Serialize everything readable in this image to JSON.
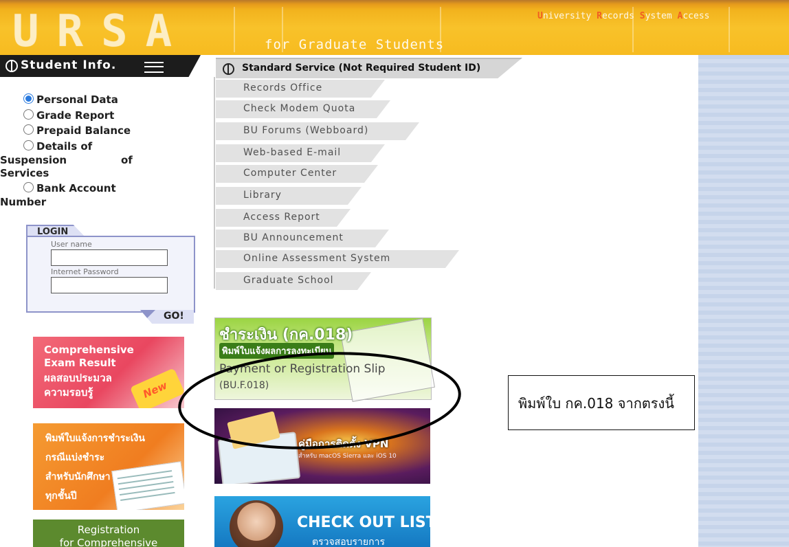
{
  "header": {
    "logo": "URSA",
    "tagline": "for Graduate Students",
    "system_title": [
      {
        "cap": "U",
        "rest": "niversity "
      },
      {
        "cap": "R",
        "rest": "ecords "
      },
      {
        "cap": "S",
        "rest": "ystem "
      },
      {
        "cap": "A",
        "rest": "ccess"
      }
    ]
  },
  "student_info": {
    "label": "Student Info.",
    "options": [
      {
        "label": "Personal Data",
        "selected": true
      },
      {
        "label": "Grade Report",
        "selected": false
      },
      {
        "label": "Prepaid Balance",
        "selected": false
      },
      {
        "label": "Details of",
        "wrap": [
          "Suspension",
          "of",
          "Services"
        ],
        "selected": false
      },
      {
        "label": "Bank Account",
        "wrap": [
          "Number"
        ],
        "selected": false
      }
    ]
  },
  "login": {
    "title": "LOGIN",
    "username_label": "User name",
    "username_value": "",
    "password_label": "Internet Password",
    "password_value": "",
    "go_label": "GO!"
  },
  "left_banners": {
    "comprehensive": {
      "line1": "Comprehensive",
      "line2": "Exam Result",
      "line3": "ผลสอบประมวล",
      "line4": "ความรอบรู้",
      "badge": "New"
    },
    "payment_notice": {
      "line1": "พิมพ์ใบแจ้งการชำระเงิน",
      "line2": "กรณีแบ่งชำระ",
      "line3": "สำหรับนักศึกษา",
      "line4": "ทุกชั้นปี"
    },
    "registration": {
      "line1": "Registration",
      "line2": "for Comprehensive"
    }
  },
  "standard_service": {
    "label": "Standard Service (Not Required Student ID)",
    "items": [
      "Records Office",
      "Check Modem Quota",
      "BU Forums (Webboard)",
      "Web-based E-mail",
      "Computer Center",
      "Library",
      "Access Report",
      "BU Announcement",
      "Online Assessment System",
      "Graduate School"
    ]
  },
  "center_banners": {
    "payment_slip": {
      "th_title": "ชำระเงิน (กค.018)",
      "th_subtitle": "พิมพ์ใบแจ้งผลการลงทะเบียน",
      "en_title": "Payment or Registration Slip",
      "code": "(BU.F.018)"
    },
    "vpn": {
      "title": "คู่มือการติดตั้ง VPN",
      "subtitle": "สำหรับ macOS Sierra และ iOS 10"
    },
    "checkout": {
      "title": "CHECK OUT LIST",
      "subtitle": "ตรวจสอบรายการ"
    }
  },
  "annotation": {
    "note": "พิมพ์ใบ กค.018 จากตรงนี้"
  },
  "colors": {
    "header_orange": "#f7bb20",
    "radio_blue": "#2a7ade",
    "login_border": "#8d93c9",
    "right_strip": "#c6d4ea"
  }
}
